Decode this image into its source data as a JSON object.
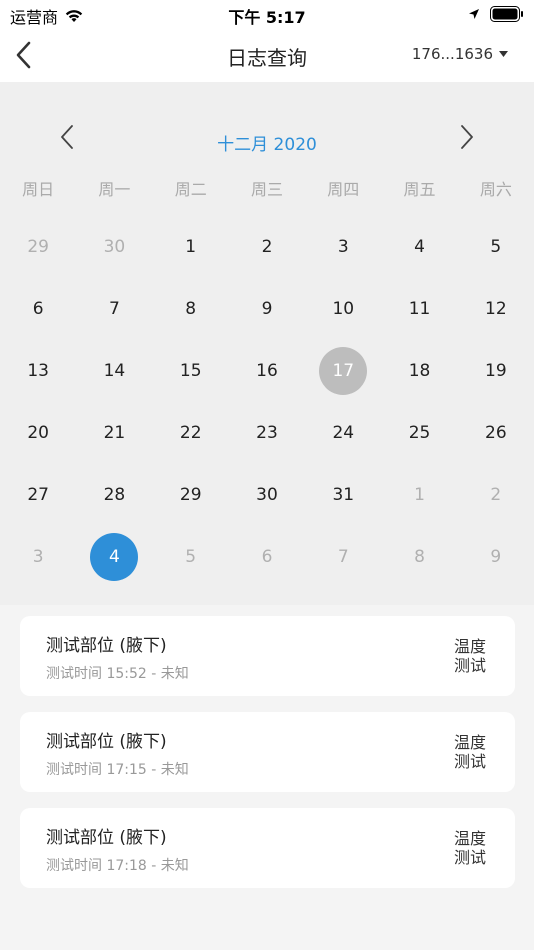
{
  "status_bar": {
    "carrier": "运营商",
    "time": "下午 5:17"
  },
  "navbar": {
    "title": "日志查询",
    "account": "176...1636"
  },
  "calendar": {
    "month_label": "十二月 2020",
    "weekdays": [
      "周日",
      "周一",
      "周二",
      "周三",
      "周四",
      "周五",
      "周六"
    ],
    "weeks": [
      [
        {
          "d": "29",
          "o": true
        },
        {
          "d": "30",
          "o": true
        },
        {
          "d": "1"
        },
        {
          "d": "2"
        },
        {
          "d": "3"
        },
        {
          "d": "4"
        },
        {
          "d": "5"
        }
      ],
      [
        {
          "d": "6"
        },
        {
          "d": "7"
        },
        {
          "d": "8"
        },
        {
          "d": "9"
        },
        {
          "d": "10"
        },
        {
          "d": "11"
        },
        {
          "d": "12"
        }
      ],
      [
        {
          "d": "13"
        },
        {
          "d": "14"
        },
        {
          "d": "15"
        },
        {
          "d": "16"
        },
        {
          "d": "17",
          "today": true
        },
        {
          "d": "18"
        },
        {
          "d": "19"
        }
      ],
      [
        {
          "d": "20"
        },
        {
          "d": "21"
        },
        {
          "d": "22"
        },
        {
          "d": "23"
        },
        {
          "d": "24"
        },
        {
          "d": "25"
        },
        {
          "d": "26"
        }
      ],
      [
        {
          "d": "27"
        },
        {
          "d": "28"
        },
        {
          "d": "29"
        },
        {
          "d": "30"
        },
        {
          "d": "31"
        },
        {
          "d": "1",
          "o": true
        },
        {
          "d": "2",
          "o": true
        }
      ],
      [
        {
          "d": "3",
          "o": true
        },
        {
          "d": "4",
          "selected": true
        },
        {
          "d": "5",
          "o": true
        },
        {
          "d": "6",
          "o": true
        },
        {
          "d": "7",
          "o": true
        },
        {
          "d": "8",
          "o": true
        },
        {
          "d": "9",
          "o": true
        }
      ]
    ]
  },
  "records": [
    {
      "title": "测试部位 (腋下)",
      "subtitle": "测试时间 15:52 - 未知",
      "type_line1": "温度",
      "type_line2": "测试"
    },
    {
      "title": "测试部位 (腋下)",
      "subtitle": "测试时间 17:15 - 未知",
      "type_line1": "温度",
      "type_line2": "测试"
    },
    {
      "title": "测试部位 (腋下)",
      "subtitle": "测试时间 17:18 - 未知",
      "type_line1": "温度",
      "type_line2": "测试"
    }
  ],
  "colors": {
    "accent": "#2e8fd8",
    "today": "#bdbdbd"
  }
}
